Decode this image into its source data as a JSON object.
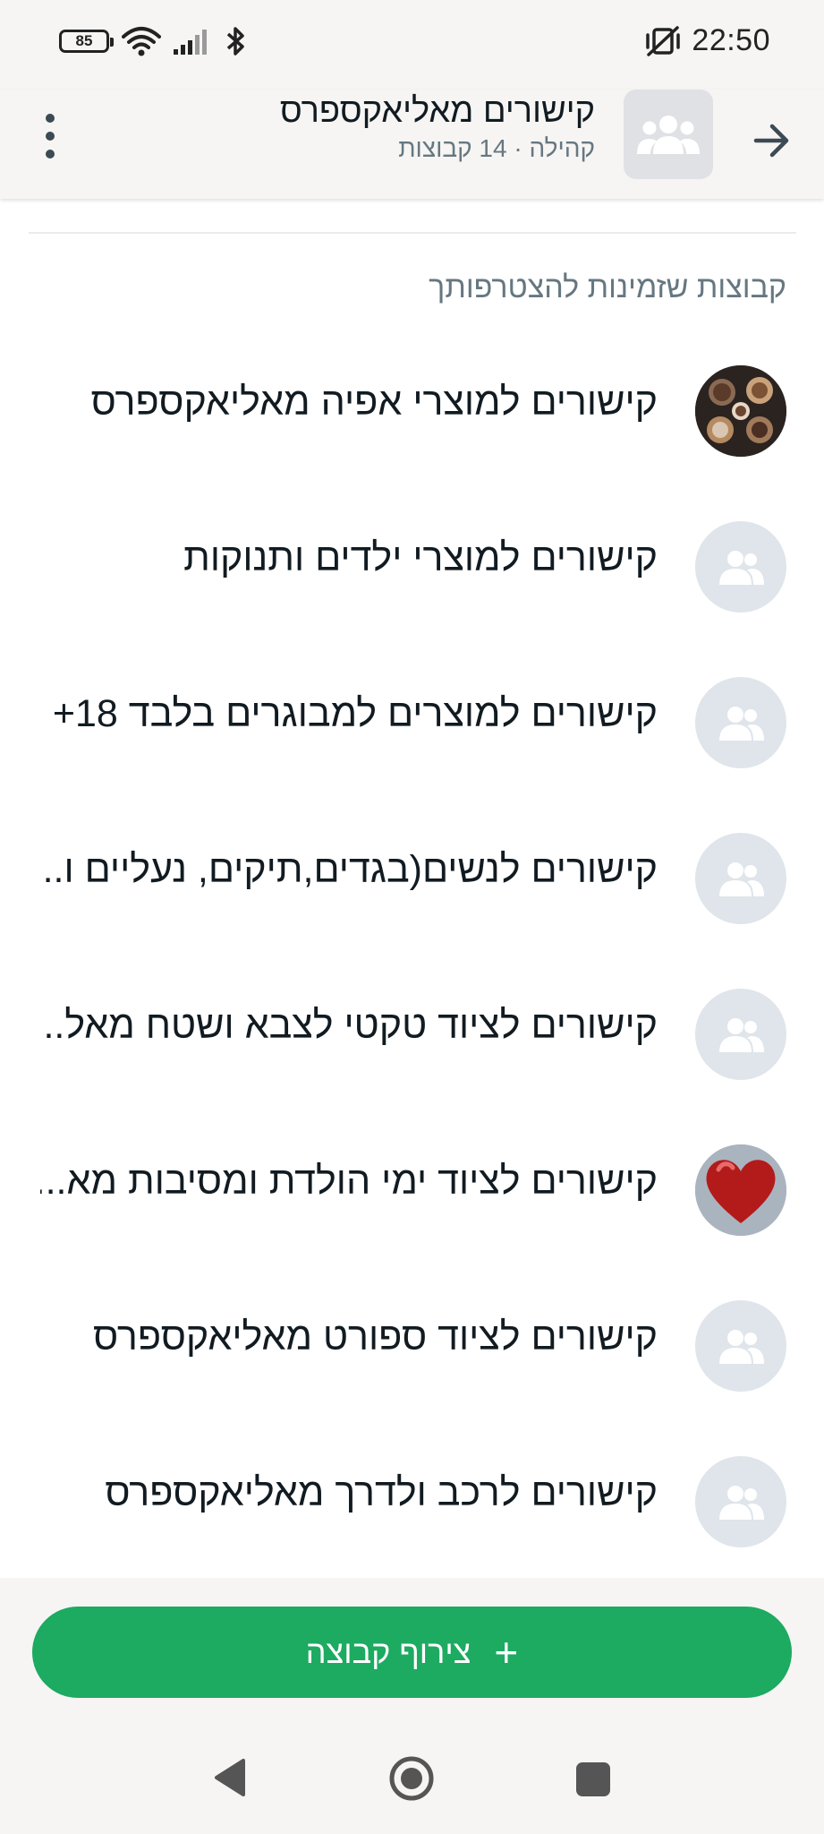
{
  "status_bar": {
    "battery": "85",
    "time": "22:50"
  },
  "header": {
    "title": "קישורים מאליאקספרס",
    "subtitle": "קהילה · 14 קבוצות"
  },
  "section": {
    "title": "קבוצות שזמינות להצטרפותך"
  },
  "groups": [
    {
      "name": "קישורים למוצרי אפיה מאליאקספרס",
      "avatar": "baking-photo"
    },
    {
      "name": "קישורים למוצרי ילדים ותנוקות",
      "avatar": "group-icon"
    },
    {
      "name": "קישורים למוצרים למבוגרים בלבד 18+",
      "avatar": "group-icon"
    },
    {
      "name": "קישורים לנשים(בגדים,תיקים, נעליים ו...",
      "avatar": "group-icon"
    },
    {
      "name": "קישורים לציוד טקטי לצבא ושטח מאל...",
      "avatar": "group-icon"
    },
    {
      "name": "קישורים לציוד ימי הולדת ומסיבות מא...",
      "avatar": "heart-balloon-photo"
    },
    {
      "name": "קישורים לציוד ספורט מאליאקספרס",
      "avatar": "group-icon"
    },
    {
      "name": "קישורים לרכב ולדרך מאליאקספרס",
      "avatar": "group-icon"
    }
  ],
  "actions": {
    "join_label": "צירוף קבוצה",
    "join_icon": "+"
  },
  "colors": {
    "accent": "#1daa61",
    "avatar_bg": "#dfe5ea",
    "secondary_text": "#667781"
  }
}
